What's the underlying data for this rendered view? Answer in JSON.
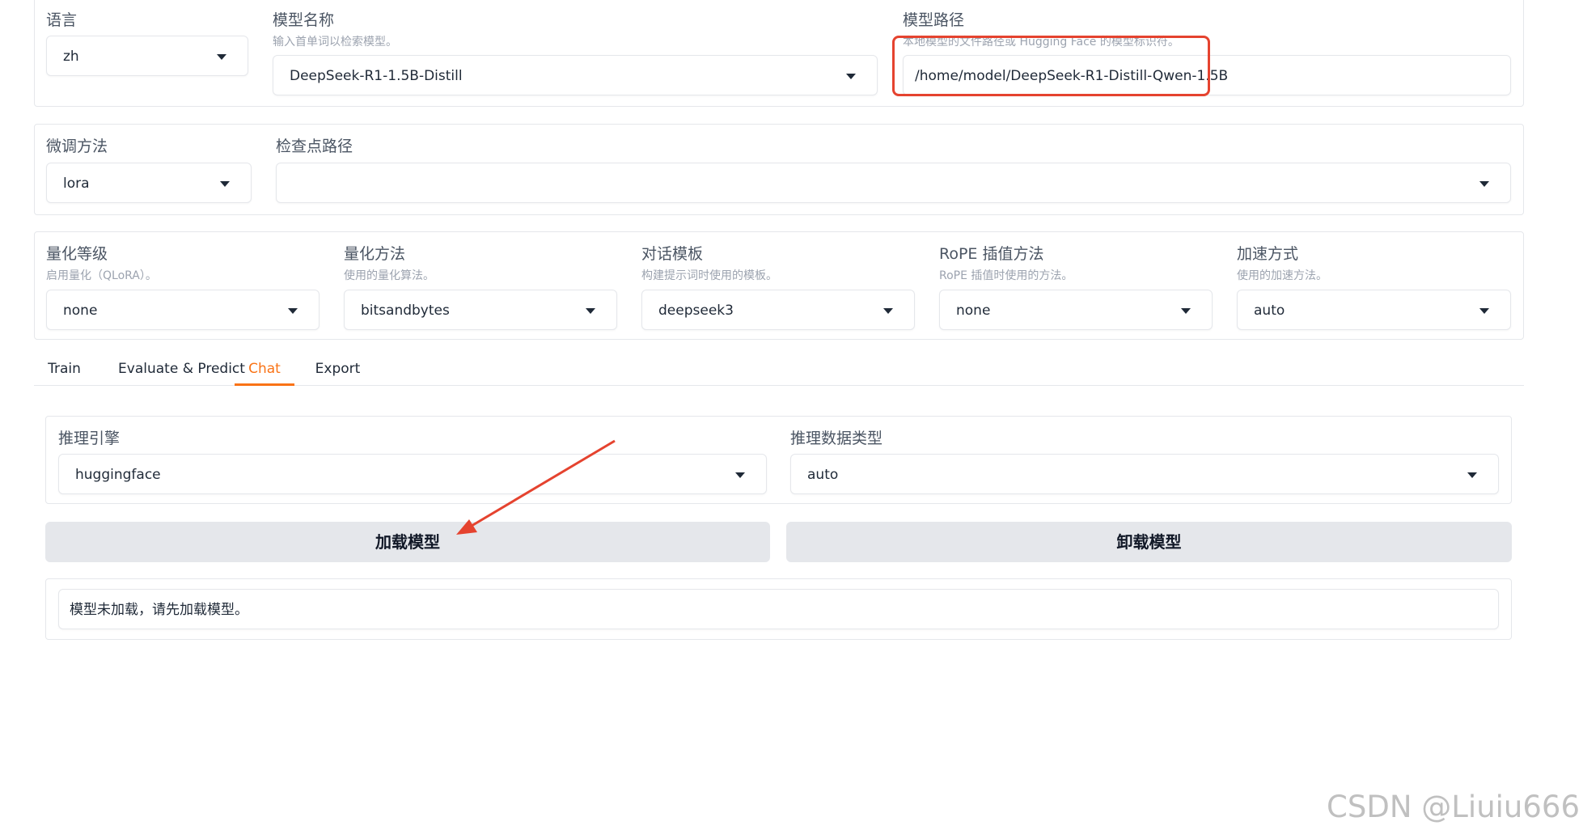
{
  "top_row": {
    "language": {
      "label": "语言",
      "value": "zh"
    },
    "model_name": {
      "label": "模型名称",
      "hint": "输入首单词以检索模型。",
      "value": "DeepSeek-R1-1.5B-Distill"
    },
    "model_path": {
      "label": "模型路径",
      "hint": "本地模型的文件路径或 Hugging Face 的模型标识符。",
      "value": "/home/model/DeepSeek-R1-Distill-Qwen-1.5B"
    }
  },
  "second_row": {
    "finetune_method": {
      "label": "微调方法",
      "value": "lora"
    },
    "checkpoint_path": {
      "label": "检查点路径",
      "value": ""
    }
  },
  "third_row": {
    "quant_bit": {
      "label": "量化等级",
      "hint": "启用量化（QLoRA）。",
      "value": "none"
    },
    "quant_method": {
      "label": "量化方法",
      "hint": "使用的量化算法。",
      "value": "bitsandbytes"
    },
    "template": {
      "label": "对话模板",
      "hint": "构建提示词时使用的模板。",
      "value": "deepseek3"
    },
    "rope": {
      "label": "RoPE 插值方法",
      "hint": "RoPE 插值时使用的方法。",
      "value": "none"
    },
    "booster": {
      "label": "加速方式",
      "hint": "使用的加速方法。",
      "value": "auto"
    }
  },
  "tabs": [
    {
      "label": "Train"
    },
    {
      "label": "Evaluate & Predict"
    },
    {
      "label": "Chat"
    },
    {
      "label": "Export"
    }
  ],
  "active_tab": "Chat",
  "chat": {
    "infer_backend": {
      "label": "推理引擎",
      "value": "huggingface"
    },
    "infer_dtype": {
      "label": "推理数据类型",
      "value": "auto"
    },
    "load_button": "加载模型",
    "unload_button": "卸载模型",
    "info_box": "模型未加载，请先加载模型。"
  },
  "annotation_color": "#e5432f",
  "accent_color": "#f97316",
  "watermark": "CSDN @Liuiu666"
}
